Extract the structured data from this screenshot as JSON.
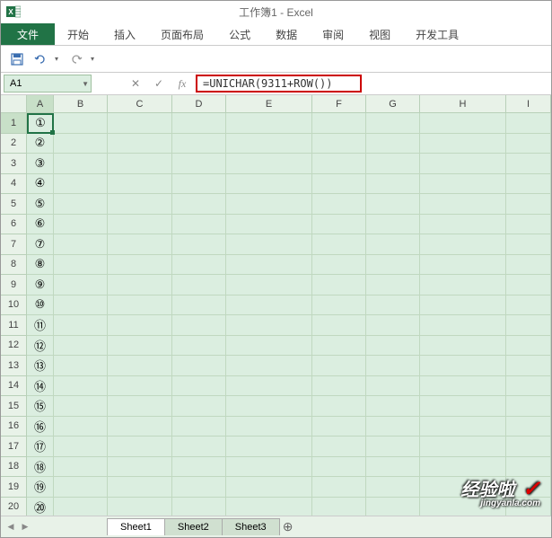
{
  "titlebar": {
    "title": "工作簿1 - Excel"
  },
  "ribbon": {
    "file": "文件",
    "tabs": [
      "开始",
      "插入",
      "页面布局",
      "公式",
      "数据",
      "审阅",
      "视图",
      "开发工具"
    ]
  },
  "nameBox": "A1",
  "formula": "=UNICHAR(9311+ROW())",
  "columns": [
    "A",
    "B",
    "C",
    "D",
    "E",
    "F",
    "G",
    "H",
    "I"
  ],
  "rows": [
    {
      "n": "1",
      "a": "①"
    },
    {
      "n": "2",
      "a": "②"
    },
    {
      "n": "3",
      "a": "③"
    },
    {
      "n": "4",
      "a": "④"
    },
    {
      "n": "5",
      "a": "⑤"
    },
    {
      "n": "6",
      "a": "⑥"
    },
    {
      "n": "7",
      "a": "⑦"
    },
    {
      "n": "8",
      "a": "⑧"
    },
    {
      "n": "9",
      "a": "⑨"
    },
    {
      "n": "10",
      "a": "⑩"
    },
    {
      "n": "11",
      "a": "⑪"
    },
    {
      "n": "12",
      "a": "⑫"
    },
    {
      "n": "13",
      "a": "⑬"
    },
    {
      "n": "14",
      "a": "⑭"
    },
    {
      "n": "15",
      "a": "⑮"
    },
    {
      "n": "16",
      "a": "⑯"
    },
    {
      "n": "17",
      "a": "⑰"
    },
    {
      "n": "18",
      "a": "⑱"
    },
    {
      "n": "19",
      "a": "⑲"
    },
    {
      "n": "20",
      "a": "⑳"
    }
  ],
  "sheets": [
    "Sheet1",
    "Sheet2",
    "Sheet3"
  ],
  "watermark": {
    "text": "经验啦",
    "sub": "jingyanla.com"
  }
}
